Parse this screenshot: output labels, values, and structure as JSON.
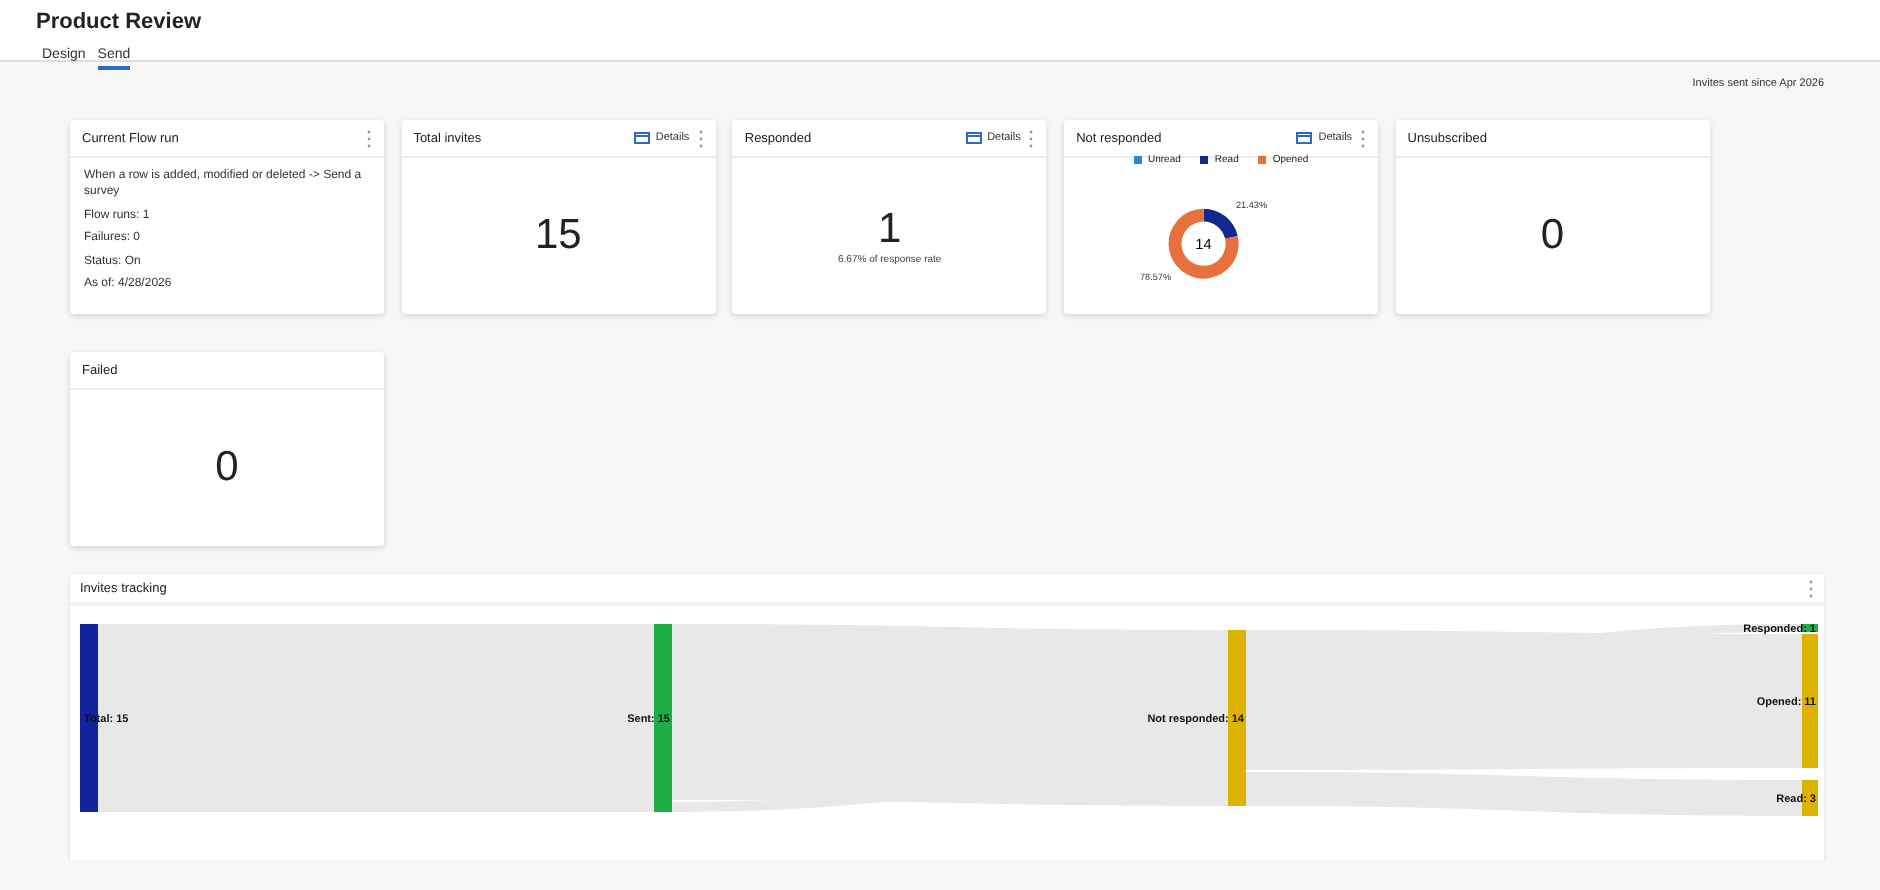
{
  "page": {
    "title": "Product Review"
  },
  "tabs": [
    {
      "label": "Design",
      "selected": false
    },
    {
      "label": "Send",
      "selected": true
    }
  ],
  "filter_note": "Invites sent since Apr 2026",
  "cards": [
    {
      "kind": "text",
      "title": "Current Flow run",
      "lines": [
        "When a row is added, modified or deleted -> Send a survey",
        "Flow runs: 1",
        "Failures: 0",
        "Status: On",
        "As of: 4/28/2026"
      ]
    },
    {
      "kind": "number",
      "title": "Total invites",
      "details": "Details",
      "value": "15"
    },
    {
      "kind": "number",
      "title": "Responded",
      "details": "Details",
      "value": "1",
      "caption": "6.67% of response rate"
    },
    {
      "kind": "donut",
      "title": "Not responded",
      "details": "Details",
      "legend": [
        {
          "color": "#2b88d8"
        },
        {
          "color": "#13288f"
        },
        {
          "color": "#e8703a"
        }
      ],
      "center_label": "14",
      "chart_data": {
        "type": "donut",
        "categories": [
          "Unread",
          "Read",
          "Opened"
        ],
        "values": [
          0,
          21.43,
          78.57
        ],
        "value_labels": [
          null,
          "21.43%",
          "78.57%"
        ]
      }
    },
    {
      "kind": "number",
      "title": "Unsubscribed",
      "value": "0"
    },
    {
      "kind": "number",
      "title": "Failed",
      "value": "0"
    }
  ],
  "tracking": {
    "title": "Invites tracking",
    "nodes": [
      {
        "label": "Total: 15",
        "color": "#13239a"
      },
      {
        "label": "Sent: 15",
        "color": "#1fad45"
      },
      {
        "label": "Not responded: 14",
        "color": "#dbb300"
      },
      {
        "label": "Responded: 1",
        "color": "#1fad45"
      },
      {
        "label": "Opened: 11",
        "color": "#dbb300"
      },
      {
        "label": "Read: 3",
        "color": "#dbb300"
      }
    ]
  }
}
